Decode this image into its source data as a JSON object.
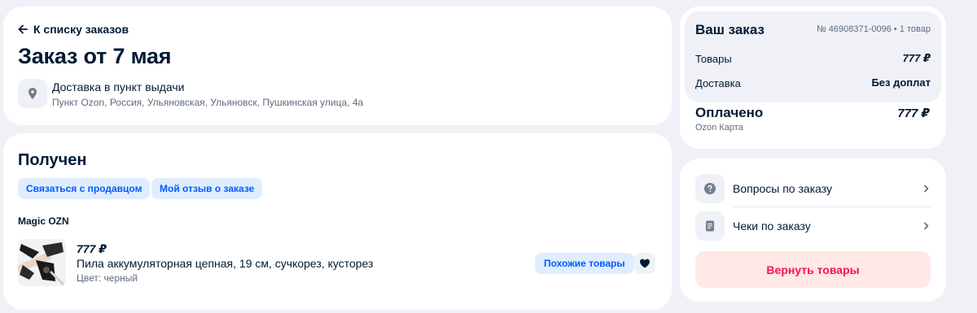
{
  "order": {
    "back_label": "К списку заказов",
    "title": "Заказ от 7 мая",
    "delivery": {
      "icon": "location-pin-icon",
      "title": "Доставка в пункт выдачи",
      "address": "Пункт Ozon, Россия, Ульяновская, Ульяновск, Пушкинская улица, 4а"
    }
  },
  "status": {
    "title": "Получен",
    "contact_seller_label": "Связаться с продавцом",
    "my_review_label": "Мой отзыв о заказе",
    "seller": "Magic OZN",
    "product": {
      "image_icon": "chainsaw-product-image",
      "price": "777 ₽",
      "name": "Пила аккумуляторная цепная, 19 см, сучкорез, кусторез",
      "color": "Цвет: черный",
      "similar_label": "Похожие товары",
      "favorite_icon": "heart-icon"
    }
  },
  "summary": {
    "title": "Ваш заказ",
    "number": "№ 46908371-0096 • 1 товар",
    "goods_label": "Товары",
    "goods_value": "777 ₽",
    "delivery_label": "Доставка",
    "delivery_value": "Без доплат",
    "paid_label": "Оплачено",
    "paid_value": "777 ₽",
    "payment_method": "Ozon Карта"
  },
  "actions": {
    "questions_label": "Вопросы по заказу",
    "questions_icon": "question-icon",
    "receipts_label": "Чеки по заказу",
    "receipts_icon": "receipt-icon",
    "return_label": "Вернуть товары"
  },
  "colors": {
    "background": "#eff1f6",
    "accent_blue": "#005bff",
    "chip_bg": "#e0edfe",
    "return_bg": "#ffe8e6",
    "return_text": "#f91155",
    "text_primary": "#001a34",
    "text_secondary": "#5c6b7e"
  }
}
